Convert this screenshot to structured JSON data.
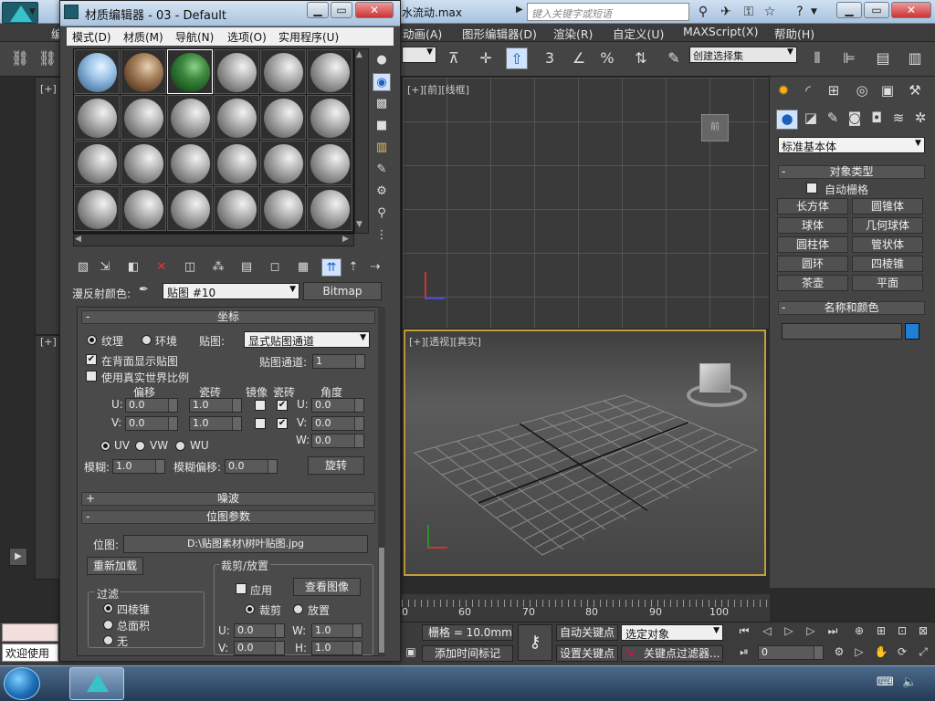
{
  "app": {
    "file_title": "水流动.max",
    "search_placeholder": "键入关键字或短语",
    "win_min": "▁",
    "win_max": "▭",
    "win_close": "✕"
  },
  "main_menu": [
    "动画(A)",
    "图形编辑器(D)",
    "渲染(R)",
    "自定义(U)",
    "MAXScript(X)",
    "帮助(H)"
  ],
  "main_menu_partial": "编",
  "toolbar": {
    "snap3": "3",
    "selection_set": "创建选择集"
  },
  "viewports": {
    "top_left_label": "[+]",
    "front_label": "[+][前][线框]",
    "persp_label": "[+][透视][真实]",
    "left_label": "[+]"
  },
  "command_panel": {
    "category": "标准基本体",
    "object_type_title": "对象类型",
    "auto_grid": "自动栅格",
    "primitives": [
      "长方体",
      "圆锥体",
      "球体",
      "几何球体",
      "圆柱体",
      "管状体",
      "圆环",
      "四棱锥",
      "茶壶",
      "平面"
    ],
    "name_color_title": "名称和颜色",
    "object_name": "",
    "accent_color": "#1e7fd6"
  },
  "timeline": {
    "ticks": [
      "0",
      "60",
      "70",
      "80",
      "90",
      "100"
    ]
  },
  "status": {
    "welcome": "欢迎使用",
    "grid": "栅格 = 10.0mm",
    "auto_key": "自动关键点",
    "set_key": "设置关键点",
    "selected_object": "选定对象",
    "key_filter": "关键点过滤器...",
    "add_time_tag": "添加时间标记",
    "frame": "0"
  },
  "material_editor": {
    "title": "材质编辑器 - 03 - Default",
    "menus": [
      "模式(D)",
      "材质(M)",
      "导航(N)",
      "选项(O)",
      "实用程序(U)"
    ],
    "diffuse_label": "漫反射颜色:",
    "map_name": "贴图 #10",
    "map_type": "Bitmap",
    "coords": {
      "title": "坐标",
      "texture": "纹理",
      "environ": "环境",
      "mapping_label": "贴图:",
      "mapping": "显式贴图通道",
      "show_back": "在背面显示贴图",
      "real_world": "使用真实世界比例",
      "channel_label": "贴图通道:",
      "channel": "1",
      "offset": "偏移",
      "tiling": "瓷砖",
      "mirror": "镜像",
      "tile": "瓷砖",
      "angle": "角度",
      "u_label": "U:",
      "v_label": "V:",
      "w_label": "W:",
      "u_offset": "0.0",
      "v_offset": "0.0",
      "u_tiling": "1.0",
      "v_tiling": "1.0",
      "u_angle": "0.0",
      "v_angle": "0.0",
      "w_angle": "0.0",
      "uv": "UV",
      "vw": "VW",
      "wu": "WU",
      "blur_label": "模糊:",
      "blur": "1.0",
      "blur_offset_label": "模糊偏移:",
      "blur_offset": "0.0",
      "rotate": "旋转"
    },
    "noise_title": "噪波",
    "bitmap_params": {
      "title": "位图参数",
      "bitmap_label": "位图:",
      "path": "D:\\贴图素材\\树叶贴图.jpg",
      "reload": "重新加载",
      "crop_title": "裁剪/放置",
      "apply": "应用",
      "view_image": "查看图像",
      "crop": "裁剪",
      "place": "放置",
      "filter_title": "过滤",
      "filter_opts": [
        "四棱锥",
        "总面积",
        "无"
      ],
      "u_label": "U:",
      "v_label": "V:",
      "w_label": "W:",
      "h_label": "H:",
      "u": "0.0",
      "v": "0.0",
      "w": "1.0",
      "h": "1.0"
    }
  }
}
